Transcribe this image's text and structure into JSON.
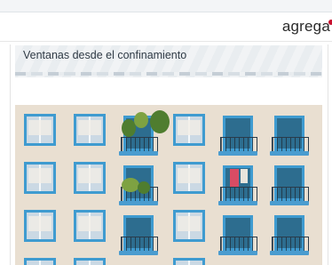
{
  "header": {
    "brand": "agrega"
  },
  "banner": {
    "title": "Ventanas desde el confinamiento"
  },
  "photo": {
    "name": "building-facade-photo"
  },
  "colors": {
    "accent": "#3f9bd0",
    "brand_dot": "#c8102e",
    "facade": "#e9dfd1"
  }
}
